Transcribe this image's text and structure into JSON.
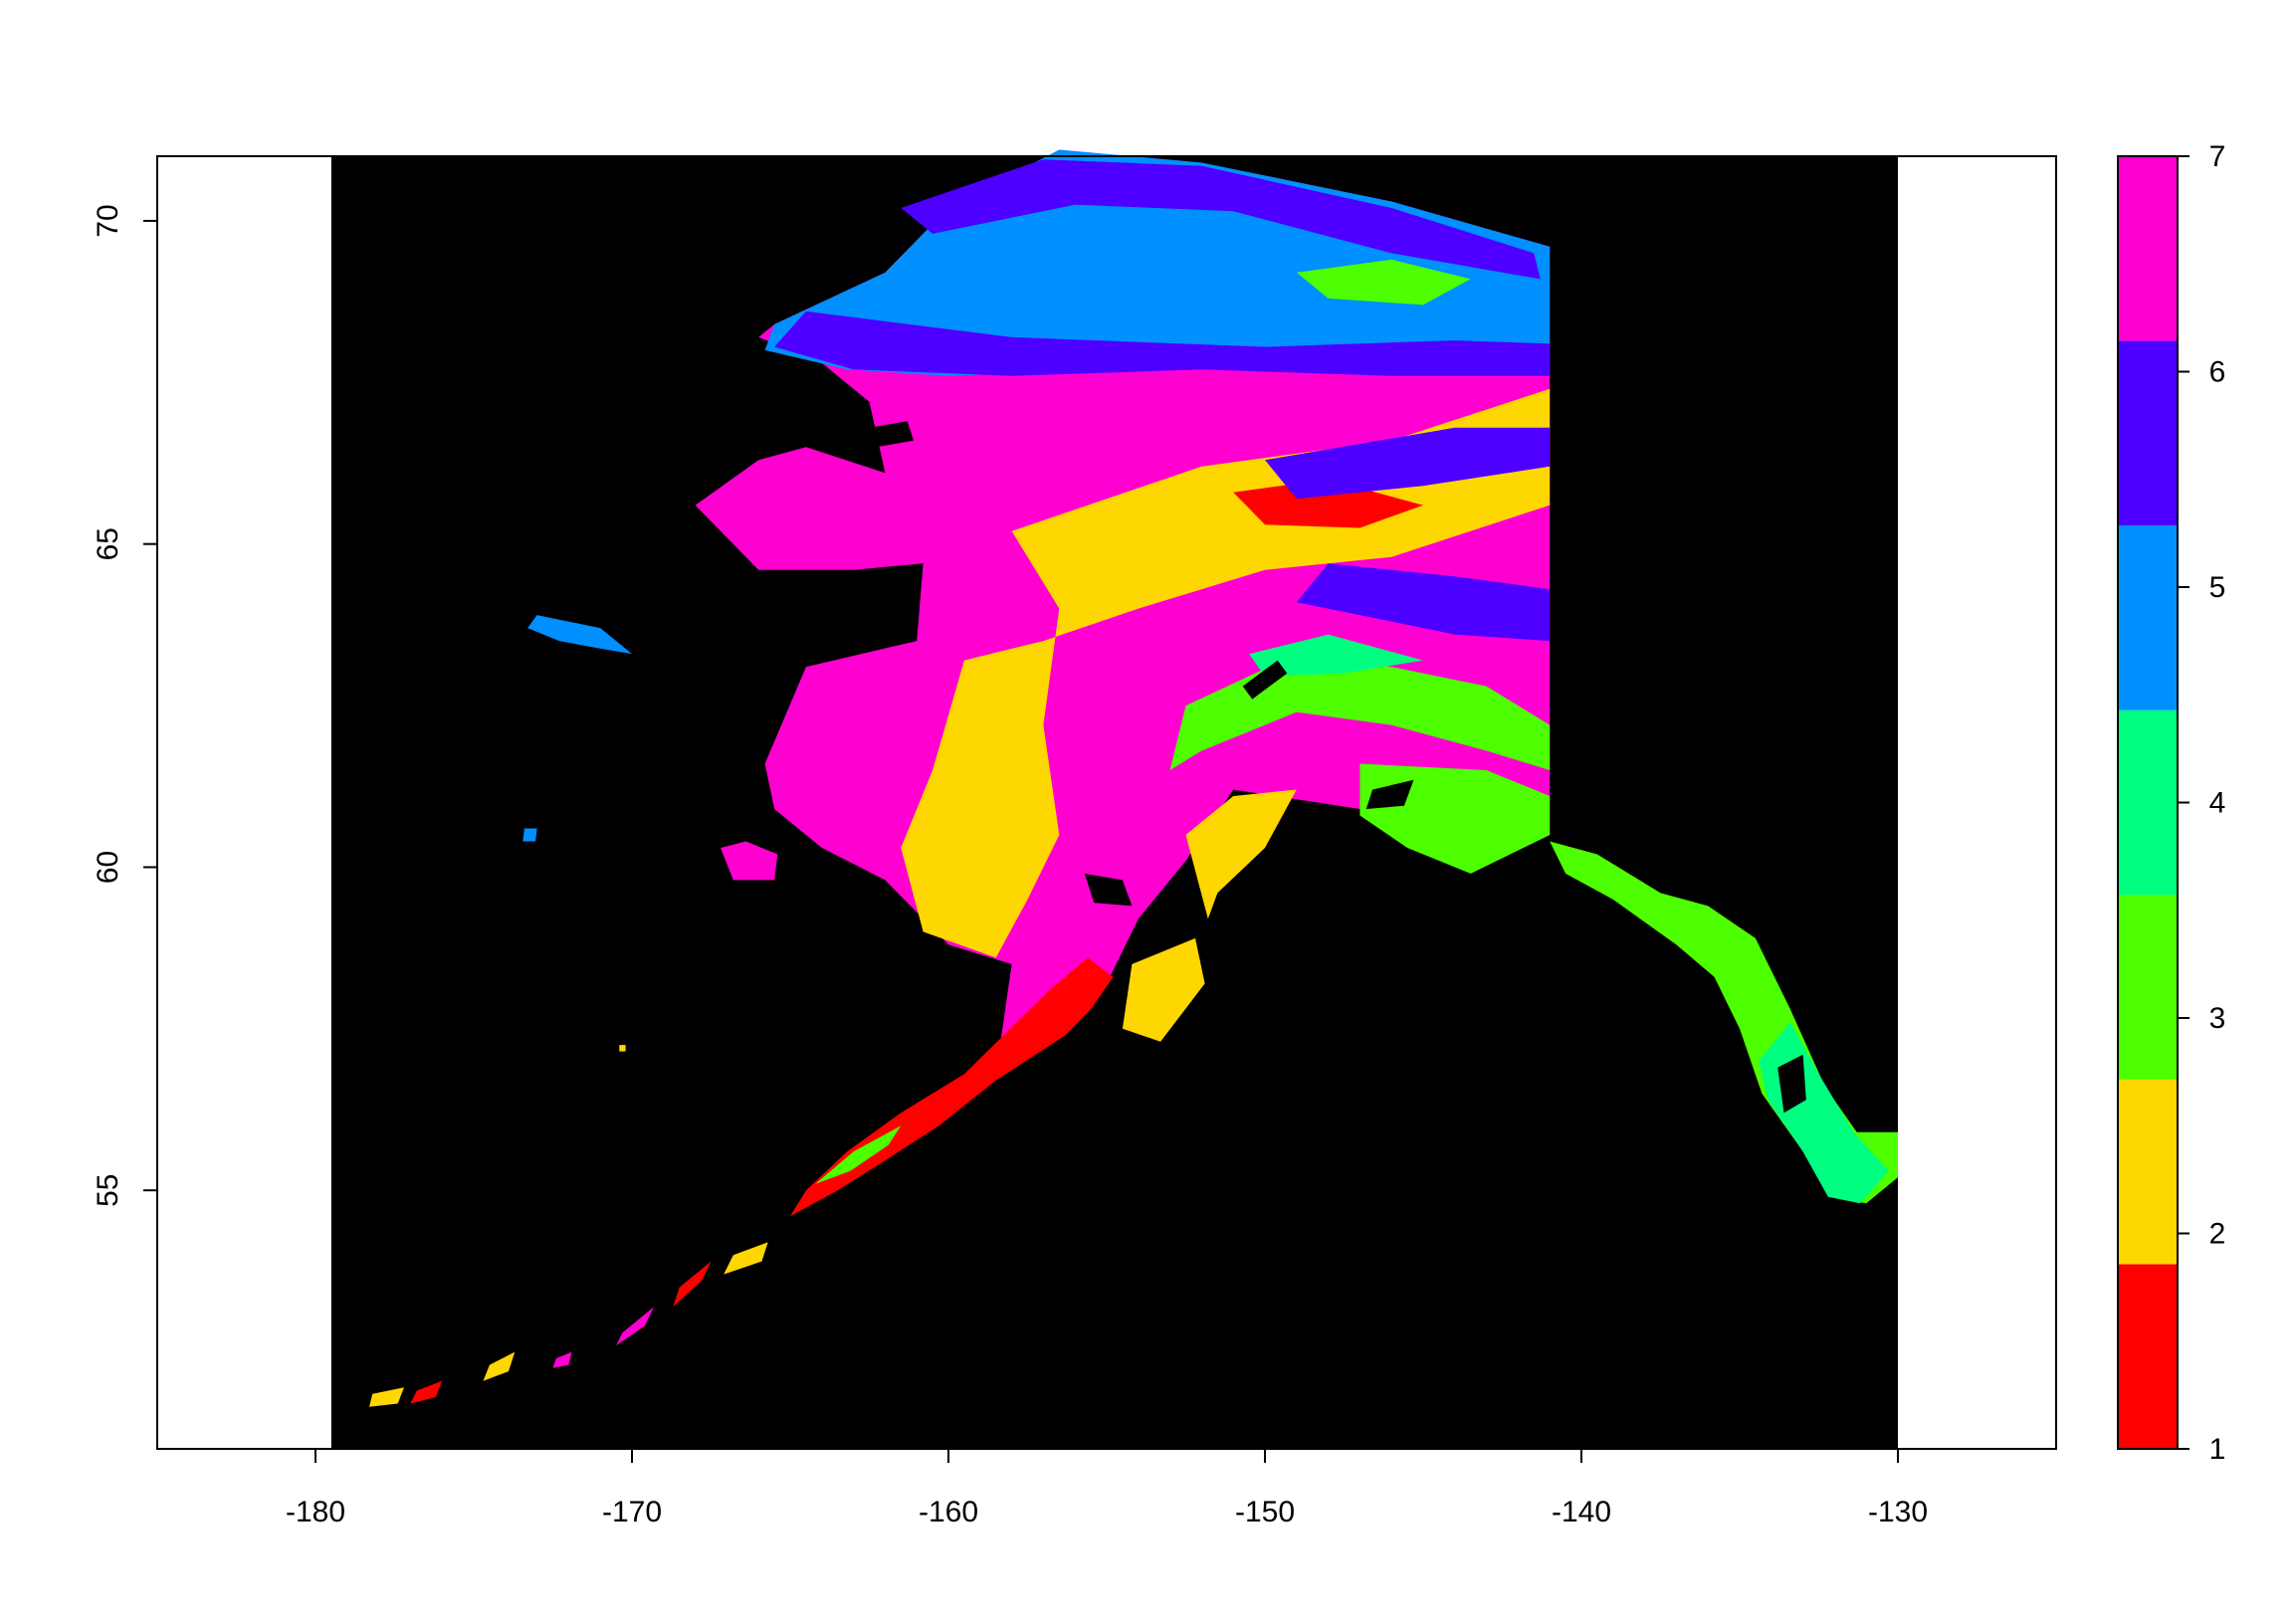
{
  "chart_data": {
    "type": "heatmap",
    "title": "",
    "xlabel": "",
    "ylabel": "",
    "xlim": [
      -185,
      -125
    ],
    "ylim": [
      51,
      71
    ],
    "raster_extent": {
      "x": [
        -179.5,
        -130
      ],
      "y": [
        51,
        71
      ]
    },
    "x_ticks": [
      -180,
      -170,
      -160,
      -150,
      -140,
      -130
    ],
    "x_tick_labels": [
      "-180",
      "-170",
      "-160",
      "-150",
      "-140",
      "-130"
    ],
    "y_ticks": [
      55,
      60,
      65,
      70
    ],
    "y_tick_labels": [
      "55",
      "60",
      "65",
      "70"
    ],
    "background_color": "#000000",
    "legend": {
      "placement": "right",
      "type": "color-bar",
      "range": [
        1,
        7
      ],
      "classes": [
        {
          "value": 1,
          "label": "1",
          "color": "#FF0000"
        },
        {
          "value": 2,
          "label": "2",
          "color": "#FFD700"
        },
        {
          "value": 3,
          "label": "3",
          "color": "#4DFF00"
        },
        {
          "value": 4,
          "label": "4",
          "color": "#00FF80"
        },
        {
          "value": 5,
          "label": "5",
          "color": "#0090FF"
        },
        {
          "value": 6,
          "label": "6",
          "color": "#4D00FF"
        },
        {
          "value": 7,
          "label": "7",
          "color": "#FF00D0"
        }
      ]
    },
    "zones": [
      {
        "value": 7,
        "polygon": [
          [
            -165.5,
            68.4
          ],
          [
            -162,
            69.2
          ],
          [
            -160,
            70.2
          ],
          [
            -156.5,
            71.1
          ],
          [
            -152,
            70.9
          ],
          [
            -146,
            70.3
          ],
          [
            -141,
            69.6
          ],
          [
            -141,
            60.5
          ],
          [
            -143.5,
            59.9
          ],
          [
            -147,
            60.9
          ],
          [
            -151,
            61.2
          ],
          [
            -152.5,
            60.1
          ],
          [
            -154,
            59.2
          ],
          [
            -155,
            58.2
          ],
          [
            -157,
            57.5
          ],
          [
            -158.5,
            56.8
          ],
          [
            -158,
            58.5
          ],
          [
            -160,
            58.8
          ],
          [
            -162,
            59.8
          ],
          [
            -164,
            60.3
          ],
          [
            -165.5,
            60.9
          ],
          [
            -165.8,
            61.6
          ],
          [
            -164.5,
            63.1
          ],
          [
            -161,
            63.5
          ],
          [
            -160.8,
            64.7
          ],
          [
            -163,
            64.6
          ],
          [
            -166,
            64.6
          ],
          [
            -168,
            65.6
          ],
          [
            -166,
            66.3
          ],
          [
            -164.5,
            66.5
          ],
          [
            -162,
            66.1
          ],
          [
            -162.5,
            67.2
          ],
          [
            -164,
            67.8
          ],
          [
            -166,
            68.2
          ]
        ]
      },
      {
        "value": 7,
        "polygon": [
          [
            -167.2,
            60.3
          ],
          [
            -166.4,
            60.4
          ],
          [
            -165.4,
            60.2
          ],
          [
            -165.5,
            59.8
          ],
          [
            -166.8,
            59.8
          ]
        ]
      },
      {
        "value": 5,
        "polygon": [
          [
            -165.5,
            68.4
          ],
          [
            -162,
            69.2
          ],
          [
            -160,
            70.2
          ],
          [
            -156.5,
            71.1
          ],
          [
            -152,
            70.9
          ],
          [
            -146,
            70.3
          ],
          [
            -141,
            69.6
          ],
          [
            -141,
            67.6
          ],
          [
            -145,
            67.7
          ],
          [
            -150,
            67.8
          ],
          [
            -155,
            67.7
          ],
          [
            -160,
            67.6
          ],
          [
            -163.2,
            67.7
          ],
          [
            -165.8,
            68.0
          ]
        ]
      },
      {
        "value": 6,
        "polygon": [
          [
            -161.5,
            70.2
          ],
          [
            -157,
            70.95
          ],
          [
            -152,
            70.85
          ],
          [
            -146,
            70.2
          ],
          [
            -141.5,
            69.5
          ],
          [
            -141.3,
            69.1
          ],
          [
            -146,
            69.5
          ],
          [
            -151,
            70.15
          ],
          [
            -156,
            70.25
          ],
          [
            -160.5,
            69.8
          ]
        ]
      },
      {
        "value": 6,
        "polygon": [
          [
            -164.5,
            68.6
          ],
          [
            -158,
            68.2
          ],
          [
            -150,
            68.05
          ],
          [
            -144,
            68.15
          ],
          [
            -141,
            68.1
          ],
          [
            -141,
            67.6
          ],
          [
            -146,
            67.6
          ],
          [
            -152,
            67.7
          ],
          [
            -158,
            67.6
          ],
          [
            -163,
            67.7
          ],
          [
            -165.5,
            68.05
          ]
        ]
      },
      {
        "value": 3,
        "polygon": [
          [
            -149,
            69.2
          ],
          [
            -146,
            69.4
          ],
          [
            -143.5,
            69.1
          ],
          [
            -145,
            68.7
          ],
          [
            -148,
            68.8
          ]
        ]
      },
      {
        "value": 2,
        "polygon": [
          [
            -158,
            65.2
          ],
          [
            -152,
            66.2
          ],
          [
            -146,
            66.6
          ],
          [
            -141,
            67.4
          ],
          [
            -141,
            65.6
          ],
          [
            -146,
            64.8
          ],
          [
            -150,
            64.6
          ],
          [
            -154,
            64.0
          ],
          [
            -157,
            63.5
          ],
          [
            -159.5,
            63.2
          ],
          [
            -160.5,
            61.5
          ],
          [
            -161.5,
            60.3
          ],
          [
            -160.8,
            59.0
          ],
          [
            -158.5,
            58.6
          ],
          [
            -157.5,
            59.5
          ],
          [
            -156.5,
            60.5
          ],
          [
            -157,
            62.2
          ],
          [
            -156.5,
            64.0
          ]
        ]
      },
      {
        "value": 1,
        "polygon": [
          [
            -151,
            65.8
          ],
          [
            -148,
            66.0
          ],
          [
            -145,
            65.6
          ],
          [
            -147,
            65.25
          ],
          [
            -150,
            65.3
          ]
        ]
      },
      {
        "value": 6,
        "polygon": [
          [
            -150,
            66.3
          ],
          [
            -144,
            66.8
          ],
          [
            -141,
            66.8
          ],
          [
            -141,
            66.2
          ],
          [
            -145,
            65.9
          ],
          [
            -149,
            65.7
          ]
        ]
      },
      {
        "value": 6,
        "polygon": [
          [
            -148,
            64.7
          ],
          [
            -144,
            64.5
          ],
          [
            -141,
            64.3
          ],
          [
            -141,
            63.5
          ],
          [
            -144,
            63.6
          ],
          [
            -147,
            63.9
          ],
          [
            -149,
            64.1
          ]
        ]
      },
      {
        "value": 3,
        "polygon": [
          [
            -152.5,
            62.5
          ],
          [
            -149,
            63.3
          ],
          [
            -146,
            63.1
          ],
          [
            -143,
            62.8
          ],
          [
            -141,
            62.2
          ],
          [
            -141,
            61.5
          ],
          [
            -143,
            61.8
          ],
          [
            -146,
            62.2
          ],
          [
            -149,
            62.4
          ],
          [
            -152,
            61.8
          ],
          [
            -153,
            61.5
          ]
        ]
      },
      {
        "value": 4,
        "polygon": [
          [
            -150.5,
            63.3
          ],
          [
            -148,
            63.6
          ],
          [
            -145,
            63.2
          ],
          [
            -147.5,
            63.0
          ],
          [
            -150,
            62.95
          ]
        ]
      },
      {
        "value": 3,
        "polygon": [
          [
            -147,
            61.6
          ],
          [
            -143,
            61.5
          ],
          [
            -141,
            61.1
          ],
          [
            -141,
            60.5
          ],
          [
            -143.5,
            59.9
          ],
          [
            -145.5,
            60.3
          ],
          [
            -147,
            60.8
          ]
        ]
      },
      {
        "value": 2,
        "polygon": [
          [
            -152.5,
            60.5
          ],
          [
            -151,
            61.1
          ],
          [
            -149,
            61.2
          ],
          [
            -150,
            60.3
          ],
          [
            -151.5,
            59.6
          ],
          [
            -151.8,
            59.2
          ]
        ]
      },
      {
        "value": 3,
        "polygon": [
          [
            -141,
            60.4
          ],
          [
            -139.5,
            60.2
          ],
          [
            -137.5,
            59.6
          ],
          [
            -136,
            59.4
          ],
          [
            -134.5,
            58.9
          ],
          [
            -133.4,
            57.8
          ],
          [
            -132.3,
            56.6
          ],
          [
            -131.3,
            55.9
          ],
          [
            -130,
            55.9
          ],
          [
            -130,
            55.2
          ],
          [
            -131,
            54.8
          ],
          [
            -132.2,
            54.9
          ],
          [
            -133,
            55.6
          ],
          [
            -134.3,
            56.5
          ],
          [
            -135,
            57.5
          ],
          [
            -135.8,
            58.3
          ],
          [
            -137,
            58.8
          ],
          [
            -139,
            59.5
          ],
          [
            -140.5,
            59.9
          ]
        ]
      },
      {
        "value": 4,
        "polygon": [
          [
            -133.4,
            57.6
          ],
          [
            -132.5,
            56.8
          ],
          [
            -131.4,
            55.9
          ],
          [
            -130.3,
            55.3
          ],
          [
            -131.2,
            54.8
          ],
          [
            -132.2,
            54.9
          ],
          [
            -133.0,
            55.6
          ],
          [
            -134.1,
            56.4
          ],
          [
            -134.4,
            57.0
          ]
        ]
      },
      {
        "value": 2,
        "polygon": [
          [
            -154.2,
            58.5
          ],
          [
            -152.2,
            58.9
          ],
          [
            -151.9,
            58.2
          ],
          [
            -153.3,
            57.3
          ],
          [
            -154.5,
            57.5
          ]
        ]
      },
      {
        "value": 1,
        "polygon": [
          [
            -156.8,
            58.1
          ],
          [
            -155.6,
            58.6
          ],
          [
            -154.8,
            58.3
          ],
          [
            -155.5,
            57.8
          ],
          [
            -156.3,
            57.4
          ],
          [
            -158.5,
            56.7
          ],
          [
            -160.3,
            56.0
          ],
          [
            -162.2,
            55.4
          ],
          [
            -163.5,
            55.0
          ],
          [
            -165,
            54.6
          ],
          [
            -164.5,
            55.0
          ],
          [
            -163.2,
            55.6
          ],
          [
            -161.5,
            56.2
          ],
          [
            -159.5,
            56.8
          ]
        ]
      },
      {
        "value": 3,
        "polygon": [
          [
            -164.2,
            55.1
          ],
          [
            -163,
            55.6
          ],
          [
            -161.5,
            56.0
          ],
          [
            -161.9,
            55.7
          ],
          [
            -163.1,
            55.3
          ]
        ]
      },
      {
        "value": 5,
        "polygon": [
          [
            -173,
            63.9
          ],
          [
            -171,
            63.7
          ],
          [
            -170,
            63.3
          ],
          [
            -171.2,
            63.4
          ],
          [
            -172.3,
            63.5
          ],
          [
            -173.3,
            63.7
          ]
        ]
      }
    ],
    "islands": [
      {
        "value": 2,
        "polygon": [
          [
            -166.8,
            54.0
          ],
          [
            -165.7,
            54.2
          ],
          [
            -165.9,
            53.9
          ],
          [
            -167.1,
            53.7
          ]
        ]
      },
      {
        "value": 1,
        "polygon": [
          [
            -168.5,
            53.5
          ],
          [
            -167.5,
            53.9
          ],
          [
            -167.8,
            53.6
          ],
          [
            -168.7,
            53.2
          ]
        ]
      },
      {
        "value": 7,
        "polygon": [
          [
            -170.3,
            52.8
          ],
          [
            -169.3,
            53.2
          ],
          [
            -169.6,
            52.9
          ],
          [
            -170.5,
            52.6
          ]
        ]
      },
      {
        "value": 2,
        "polygon": [
          [
            -174.5,
            52.3
          ],
          [
            -173.7,
            52.5
          ],
          [
            -173.9,
            52.2
          ],
          [
            -174.7,
            52.05
          ]
        ]
      },
      {
        "value": 1,
        "polygon": [
          [
            -176.8,
            51.9
          ],
          [
            -176.0,
            52.05
          ],
          [
            -176.2,
            51.8
          ],
          [
            -177.0,
            51.7
          ]
        ]
      },
      {
        "value": 2,
        "polygon": [
          [
            -178.2,
            51.85
          ],
          [
            -177.2,
            51.95
          ],
          [
            -177.4,
            51.7
          ],
          [
            -178.3,
            51.65
          ]
        ]
      },
      {
        "value": 7,
        "polygon": [
          [
            -172.4,
            52.4
          ],
          [
            -171.9,
            52.5
          ],
          [
            -172.0,
            52.3
          ],
          [
            -172.5,
            52.25
          ]
        ]
      },
      {
        "value": 5,
        "polygon": [
          [
            -173.4,
            60.6
          ],
          [
            -173.0,
            60.6
          ],
          [
            -173.05,
            60.4
          ],
          [
            -173.45,
            60.4
          ]
        ]
      },
      {
        "value": 2,
        "polygon": [
          [
            -170.4,
            57.25
          ],
          [
            -170.2,
            57.25
          ],
          [
            -170.2,
            57.15
          ],
          [
            -170.4,
            57.15
          ]
        ]
      }
    ],
    "water": [
      {
        "polygon": [
          [
            -162.5,
            66.8
          ],
          [
            -161.3,
            66.9
          ],
          [
            -161.1,
            66.6
          ],
          [
            -162.3,
            66.5
          ]
        ]
      },
      {
        "polygon": [
          [
            -155.7,
            59.9
          ],
          [
            -154.5,
            59.8
          ],
          [
            -154.2,
            59.4
          ],
          [
            -155.4,
            59.45
          ]
        ]
      },
      {
        "polygon": [
          [
            -150.7,
            62.8
          ],
          [
            -149.6,
            63.2
          ],
          [
            -149.3,
            63.0
          ],
          [
            -150.4,
            62.6
          ]
        ]
      },
      {
        "polygon": [
          [
            -146.6,
            61.2
          ],
          [
            -145.3,
            61.35
          ],
          [
            -145.6,
            60.95
          ],
          [
            -146.8,
            60.9
          ]
        ]
      },
      {
        "polygon": [
          [
            -133.8,
            56.9
          ],
          [
            -133.0,
            57.1
          ],
          [
            -132.9,
            56.4
          ],
          [
            -133.6,
            56.2
          ]
        ]
      }
    ]
  }
}
